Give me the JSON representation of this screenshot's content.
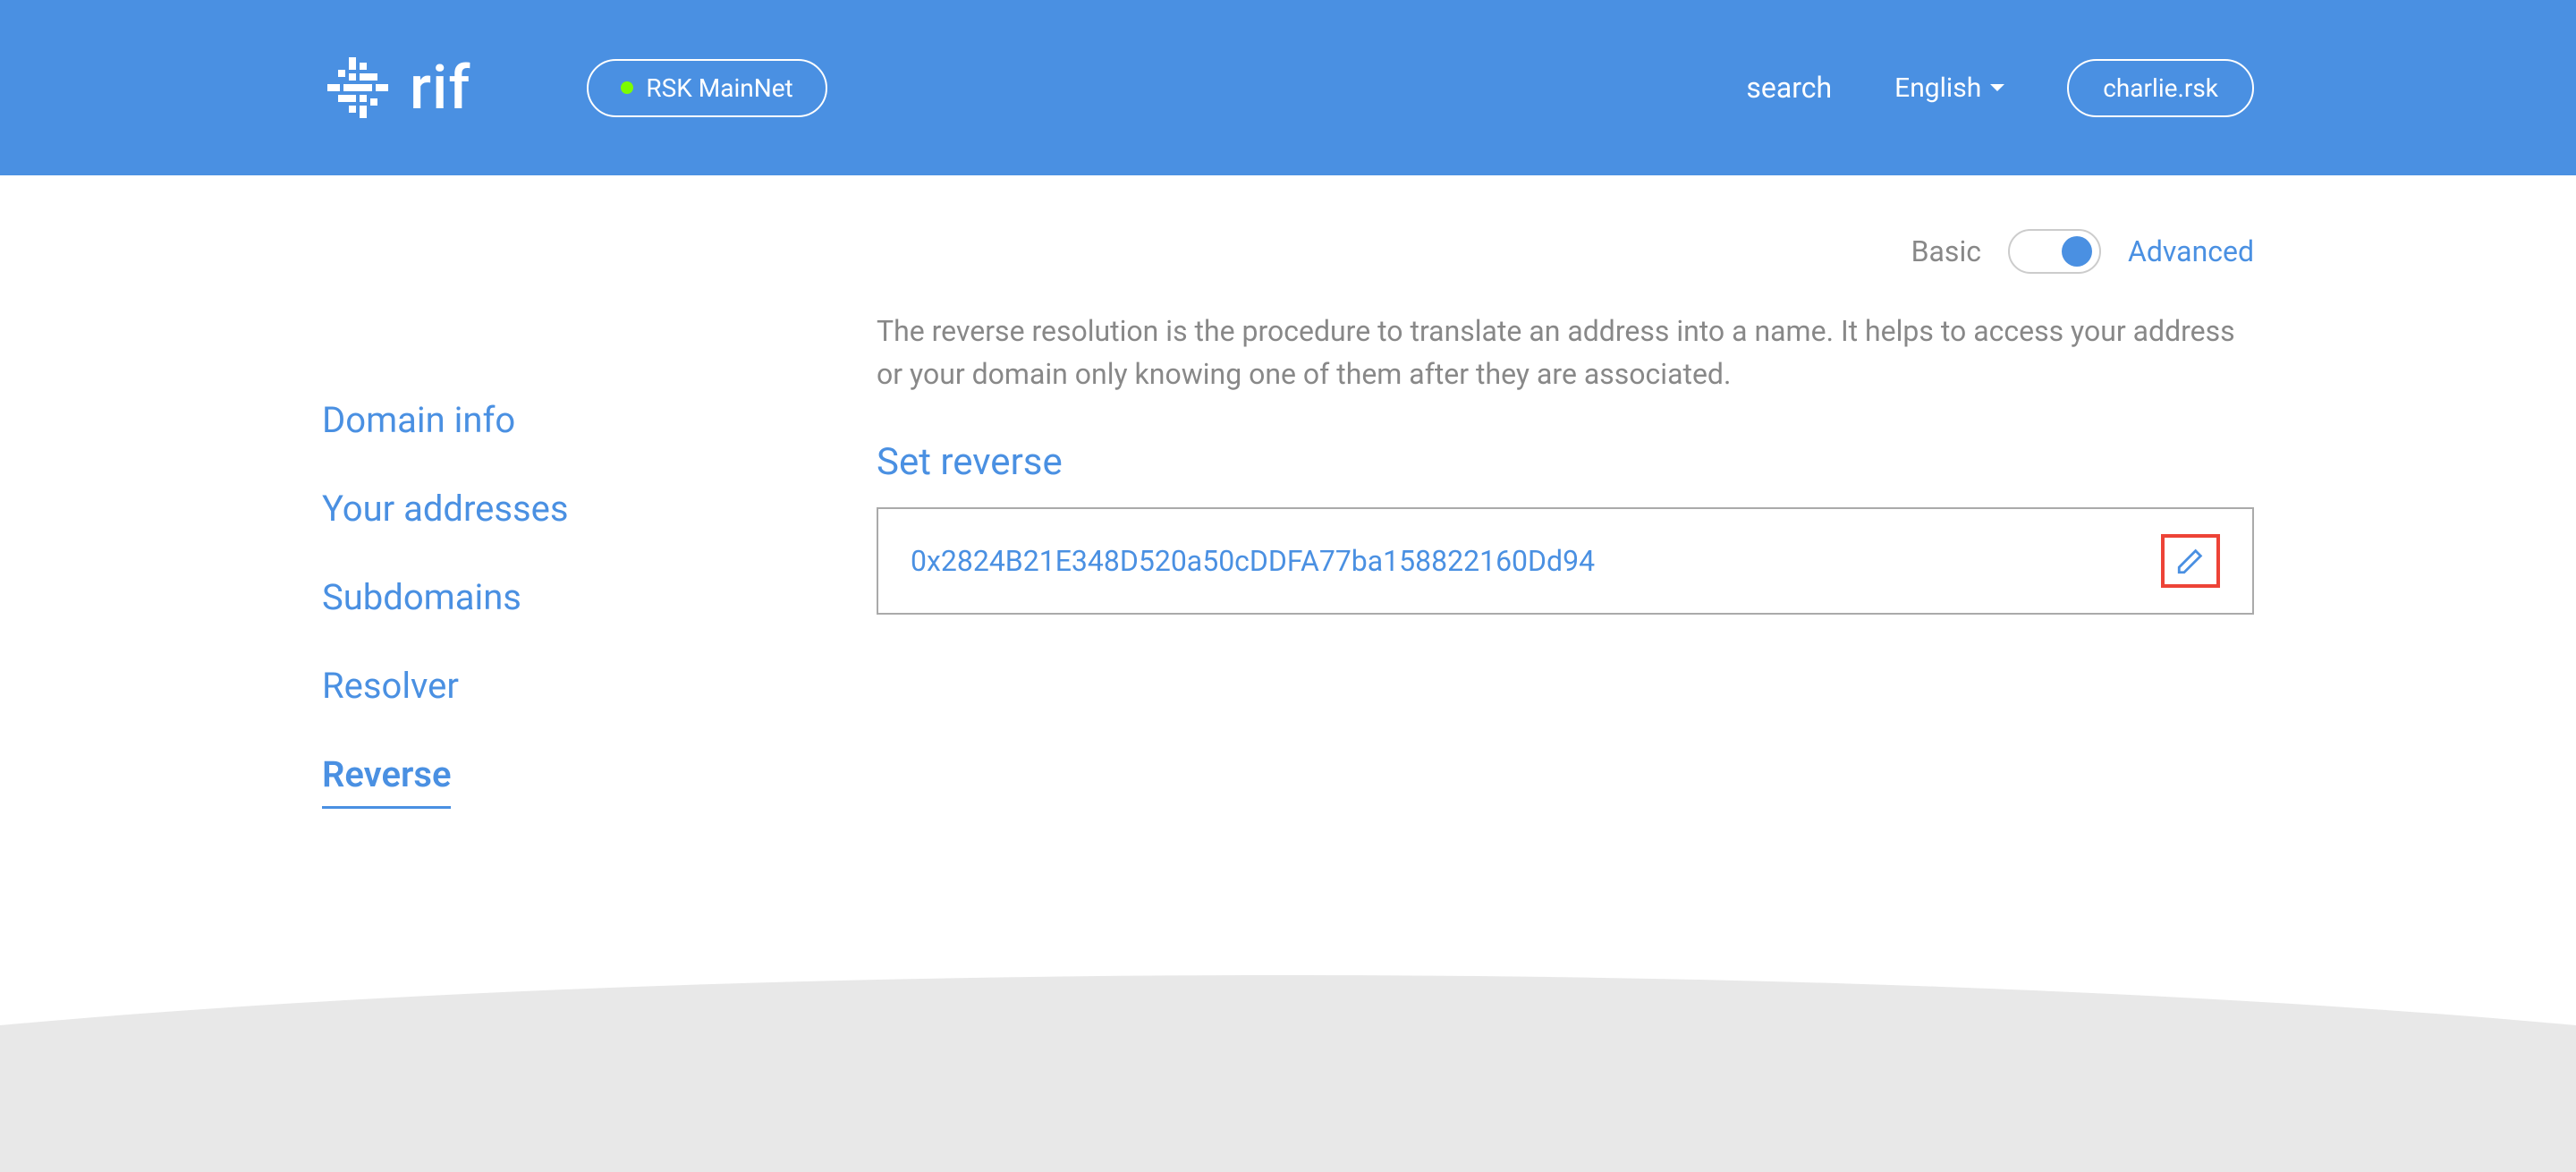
{
  "header": {
    "logo_text": "rif",
    "network_label": "RSK MainNet",
    "search_label": "search",
    "language_label": "English",
    "user_badge": "charlie.rsk"
  },
  "sidebar": {
    "items": [
      {
        "label": "Domain info"
      },
      {
        "label": "Your addresses"
      },
      {
        "label": "Subdomains"
      },
      {
        "label": "Resolver"
      },
      {
        "label": "Reverse"
      }
    ]
  },
  "toggle": {
    "basic_label": "Basic",
    "advanced_label": "Advanced"
  },
  "content": {
    "description": "The reverse resolution is the procedure to translate an address into a name. It helps to access your address or your domain only knowing one of them after they are associated.",
    "section_title": "Set reverse",
    "address": "0x2824B21E348D520a50cDDFA77ba158822160Dd94"
  }
}
